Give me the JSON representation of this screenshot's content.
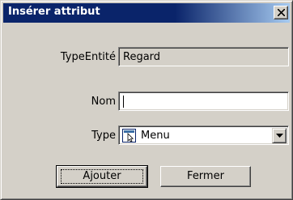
{
  "window": {
    "title": "Insérer attribut",
    "close_icon": "close-icon"
  },
  "form": {
    "type_entite": {
      "label": "TypeEntité",
      "value": "Regard"
    },
    "nom": {
      "label": "Nom",
      "value": "",
      "placeholder": ""
    },
    "type": {
      "label": "Type",
      "selected": "Menu",
      "icon": "menu-cursor-icon"
    }
  },
  "buttons": {
    "ajouter": "Ajouter",
    "fermer": "Fermer"
  },
  "colors": {
    "titlebar": "#0a246a",
    "face": "#d4d0c8"
  }
}
